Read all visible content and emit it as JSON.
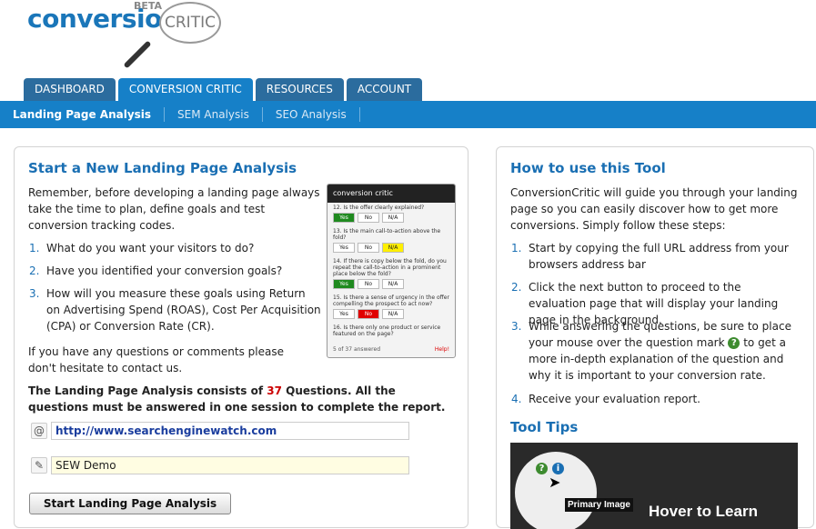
{
  "logo": {
    "word": "conversion",
    "beta": "BETA",
    "critic": "CRITIC"
  },
  "tabs": [
    "DASHBOARD",
    "CONVERSION CRITIC",
    "RESOURCES",
    "ACCOUNT"
  ],
  "subnav": [
    "Landing Page Analysis",
    "SEM Analysis",
    "SEO Analysis"
  ],
  "left": {
    "title": "Start a New Landing Page Analysis",
    "intro": "Remember, before developing a landing page always take the time to plan, define goals and test conversion tracking codes.",
    "steps": [
      {
        "num": "1.",
        "text": "What do you want your visitors to do?"
      },
      {
        "num": "2.",
        "text": "Have you identified your conversion goals?"
      },
      {
        "num": "3.",
        "text": "How will you measure these goals using Return on Advertising Spend (ROAS), Cost Per Acquisition (CPA) or Conversion Rate (CR)."
      }
    ],
    "contact": "If you have any questions or comments please don't hesitate to contact us.",
    "summary_pre": "The Landing Page Analysis consists of ",
    "summary_count": "37",
    "summary_post": " Questions. All the questions must be answered in one session to complete the report.",
    "url_value": "http://www.searchenginewatch.com",
    "name_value": "SEW Demo",
    "start_button": "Start Landing Page Analysis",
    "preview": {
      "bar": "conversion critic",
      "q12": "12. Is the offer clearly explained?",
      "q13": "13. Is the main call-to-action above the fold?",
      "q14": "14. If there is copy below the fold, do you repeat the call-to-action in a prominent place below the fold?",
      "q15": "15. Is there a sense of urgency in the offer compelling the prospect to act now?",
      "q16": "16. Is there only one product or service featured on the page?",
      "progress": "5 of 37 answered",
      "help": "Help!",
      "opts": [
        "Yes",
        "No",
        "N/A"
      ]
    }
  },
  "right": {
    "title": "How to use this Tool",
    "intro": "ConversionCritic will guide you through your landing page so you can easily discover how to get more conversions. Simply follow these steps:",
    "steps": [
      {
        "num": "1.",
        "text": "Start by copying the full URL address from your browsers address bar"
      },
      {
        "num": "2.",
        "text": "Click the next button to proceed to the evaluation page that will display your landing page in the background."
      },
      {
        "num": "3.",
        "text_pre": "While answering the questions, be sure to place your mouse over the question mark",
        "text_post": " to get a more in-depth explanation of the question and why it is important to your conversion rate."
      },
      {
        "num": "4.",
        "text": "Receive your evaluation report."
      }
    ],
    "tooltips_title": "Tool Tips",
    "tip_primary": "Primary Image",
    "tip_hover": "Hover to Learn"
  }
}
